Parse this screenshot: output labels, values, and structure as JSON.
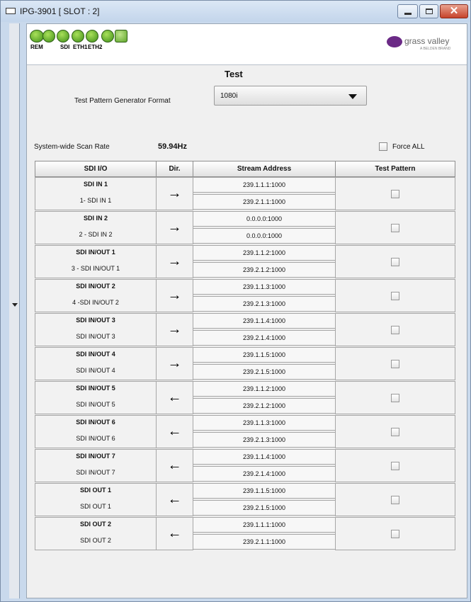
{
  "window": {
    "title": "IPG-3901   [ SLOT : 2]"
  },
  "toolbar": {
    "labels": [
      "REM",
      "SDI",
      "ETH1",
      "ETH2"
    ],
    "icon_names": [
      "ctrl-status-icon",
      "forward-icon",
      "sdi-status-icon",
      "eth1-status-icon",
      "eth2-status-icon",
      "add-icon",
      "refresh-icon"
    ],
    "accent_green": "#4c9a1e",
    "logo": {
      "text": "grass valley",
      "sub": "A BELDEN BRAND",
      "color": "#6b2a86"
    }
  },
  "test": {
    "section_title": "Test",
    "format_label": "Test Pattern Generator Format",
    "format_value": "1080i",
    "scan_label": "System-wide Scan Rate",
    "scan_value": "59.94Hz",
    "force_all_label": "Force ALL",
    "force_all_checked": false
  },
  "table": {
    "columns": [
      "SDI I/O",
      "Dir.",
      "Stream Address",
      "Test Pattern"
    ],
    "rows": [
      {
        "name": "SDI IN 1",
        "sub": "1- SDI IN 1",
        "dir": "→",
        "addr1": "239.1.1.1:1000",
        "addr2": "239.2.1.1:1000",
        "test_pattern": false
      },
      {
        "name": "SDI IN 2",
        "sub": "2 - SDI IN 2",
        "dir": "→",
        "addr1": "0.0.0.0:1000",
        "addr2": "0.0.0.0:1000",
        "test_pattern": false
      },
      {
        "name": "SDI IN/OUT 1",
        "sub": "3 - SDI IN/OUT 1",
        "dir": "→",
        "addr1": "239.1.1.2:1000",
        "addr2": "239.2.1.2:1000",
        "test_pattern": false
      },
      {
        "name": "SDI IN/OUT 2",
        "sub": "4 -SDI IN/OUT 2",
        "dir": "→",
        "addr1": "239.1.1.3:1000",
        "addr2": "239.2.1.3:1000",
        "test_pattern": false
      },
      {
        "name": "SDI IN/OUT 3",
        "sub": "SDI IN/OUT 3",
        "dir": "→",
        "addr1": "239.1.1.4:1000",
        "addr2": "239.2.1.4:1000",
        "test_pattern": false
      },
      {
        "name": "SDI IN/OUT 4",
        "sub": "SDI IN/OUT 4",
        "dir": "→",
        "addr1": "239.1.1.5:1000",
        "addr2": "239.2.1.5:1000",
        "test_pattern": false
      },
      {
        "name": "SDI IN/OUT 5",
        "sub": "SDI IN/OUT 5",
        "dir": "←",
        "addr1": "239.1.1.2:1000",
        "addr2": "239.2.1.2:1000",
        "test_pattern": false
      },
      {
        "name": "SDI IN/OUT 6",
        "sub": "SDI IN/OUT 6",
        "dir": "←",
        "addr1": "239.1.1.3:1000",
        "addr2": "239.2.1.3:1000",
        "test_pattern": false
      },
      {
        "name": "SDI IN/OUT 7",
        "sub": "SDI IN/OUT 7",
        "dir": "←",
        "addr1": "239.1.1.4:1000",
        "addr2": "239.2.1.4:1000",
        "test_pattern": false
      },
      {
        "name": "SDI OUT 1",
        "sub": "SDI OUT 1",
        "dir": "←",
        "addr1": "239.1.1.5:1000",
        "addr2": "239.2.1.5:1000",
        "test_pattern": false
      },
      {
        "name": "SDI OUT 2",
        "sub": "SDI OUT 2",
        "dir": "←",
        "addr1": "239.1.1.1:1000",
        "addr2": "239.2.1.1:1000",
        "test_pattern": false
      }
    ]
  }
}
